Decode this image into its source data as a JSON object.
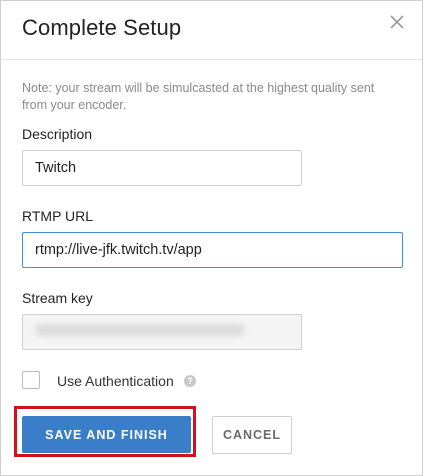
{
  "dialog": {
    "title": "Complete Setup",
    "close_icon": "close-icon"
  },
  "form": {
    "note": "Note: your stream will be simulcasted at the highest quality sent from your encoder.",
    "description": {
      "label": "Description",
      "value": "Twitch"
    },
    "rtmp_url": {
      "label": "RTMP URL",
      "value": "rtmp://live-jfk.twitch.tv/app"
    },
    "stream_key": {
      "label": "Stream key",
      "value": ""
    },
    "use_authentication": {
      "label": "Use Authentication",
      "checked": false,
      "help_icon": "help-icon",
      "help_glyph": "?"
    }
  },
  "actions": {
    "primary_label": "SAVE AND FINISH",
    "secondary_label": "CANCEL"
  },
  "colors": {
    "primary": "#3a7dc9",
    "highlight": "#d0121a",
    "focus": "#3d8fd6"
  }
}
